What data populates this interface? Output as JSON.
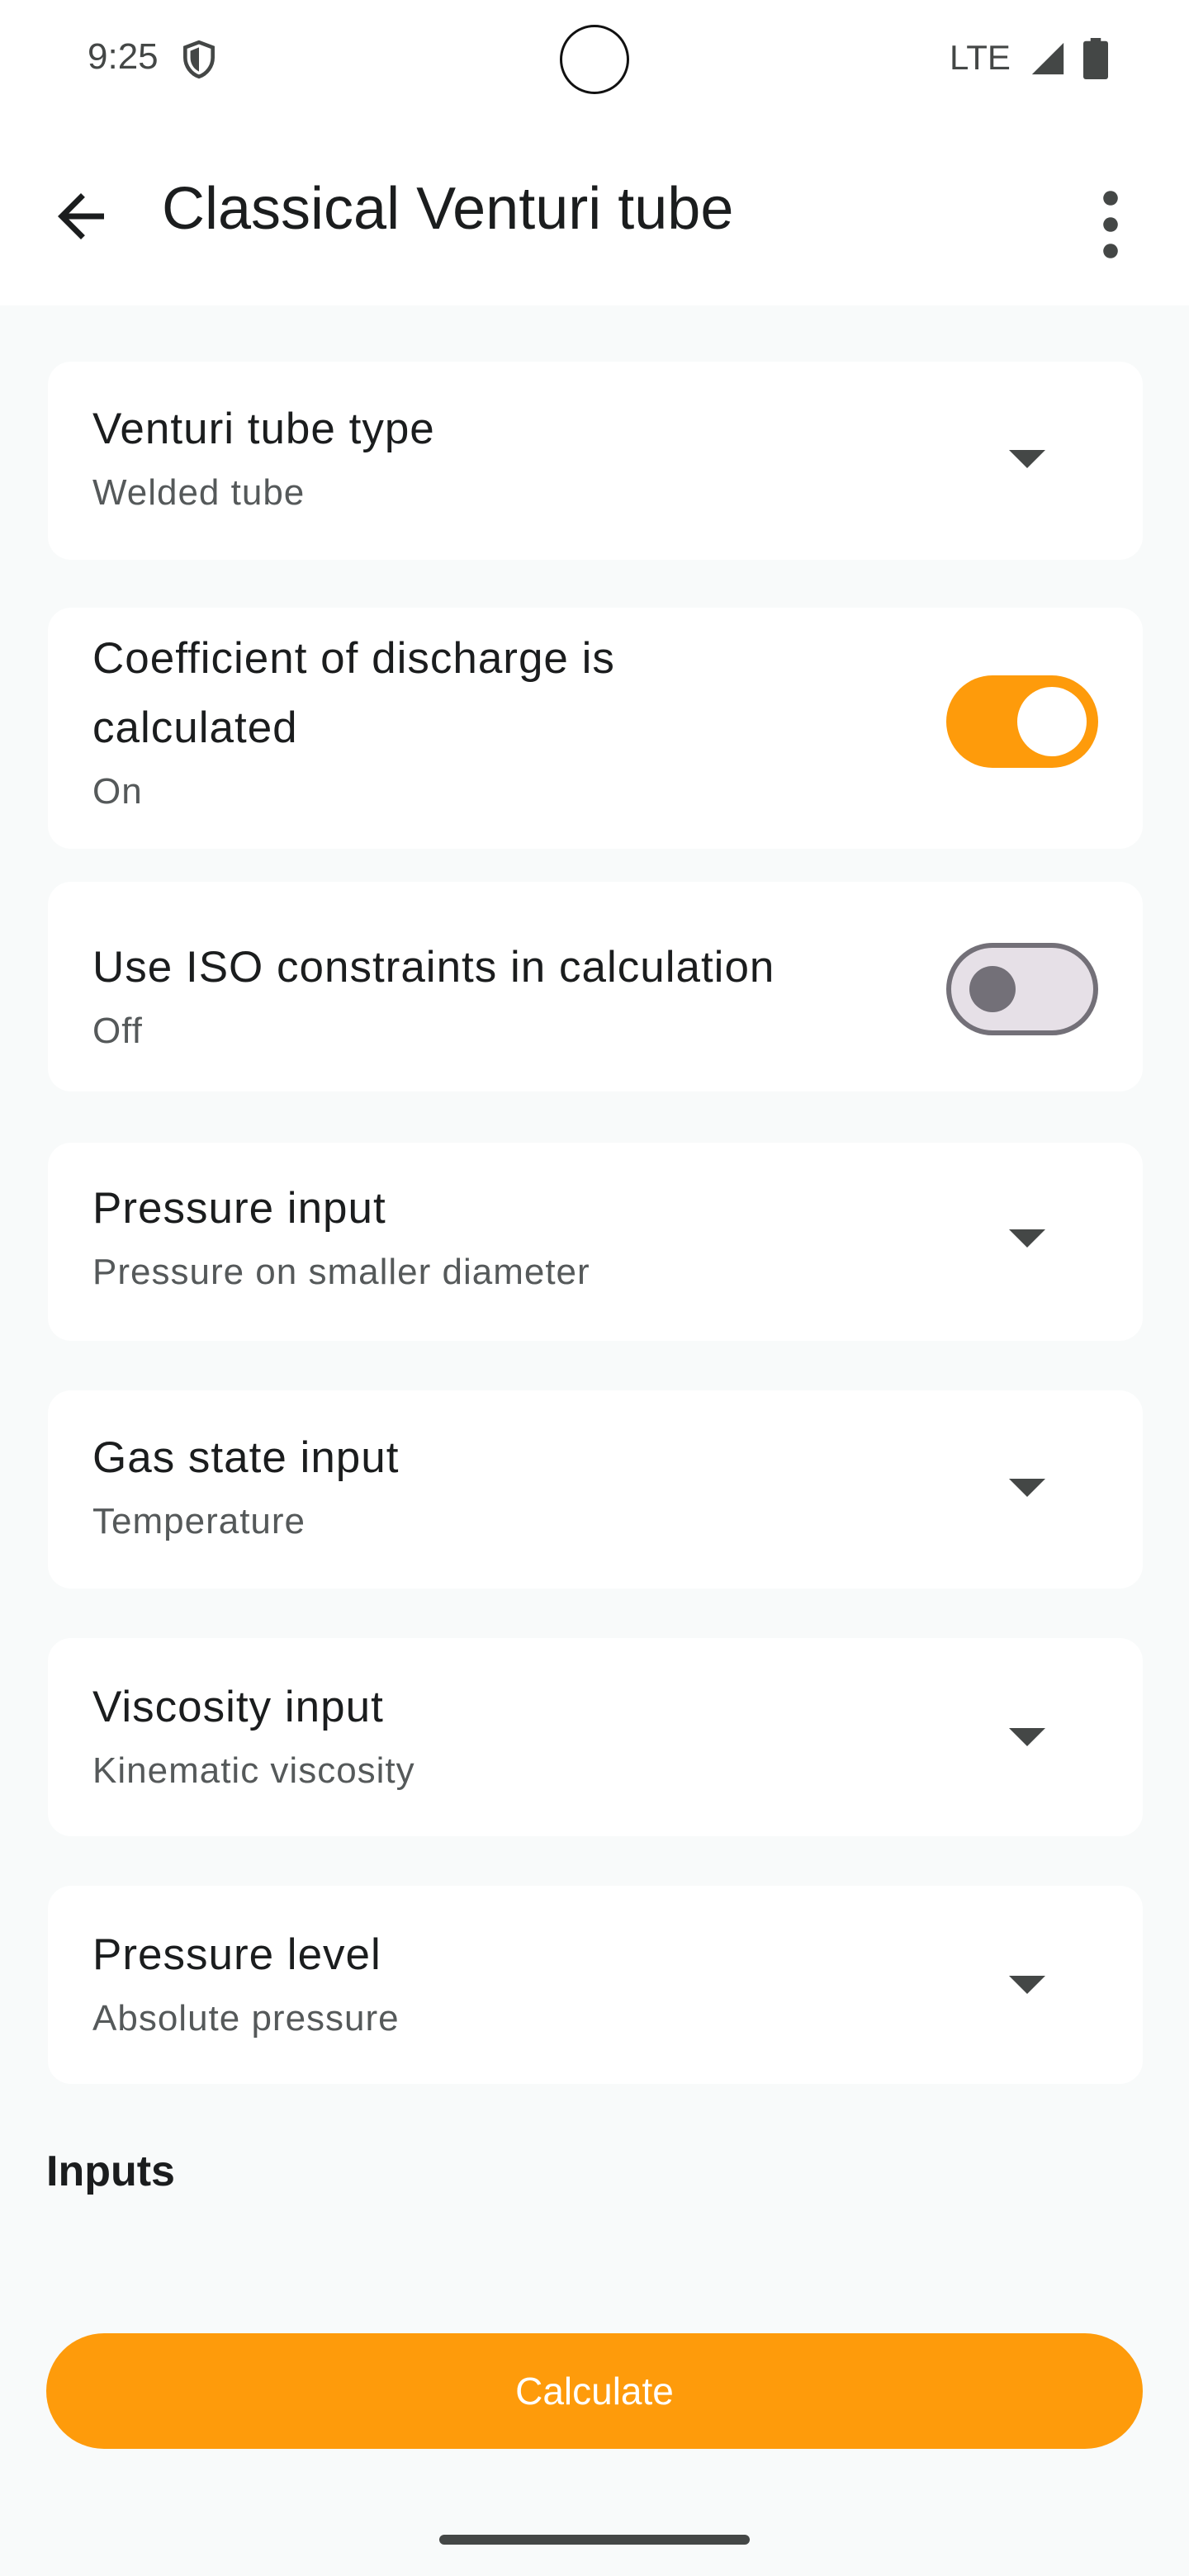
{
  "status_bar": {
    "time": "9:25",
    "network": "LTE",
    "icons": [
      "shield-icon",
      "signal-icon",
      "battery-icon"
    ]
  },
  "app_bar": {
    "title": "Classical Venturi tube",
    "back_icon": "arrow-back-icon",
    "menu_icon": "more-vert-icon"
  },
  "settings": [
    {
      "title": "Venturi tube type",
      "value": "Welded tube",
      "control": "dropdown"
    },
    {
      "title_line1": "Coefficient of discharge is",
      "title_line2": "calculated",
      "value": "On",
      "control": "toggle",
      "checked": true
    },
    {
      "title": "Use ISO constraints in calculation",
      "value": "Off",
      "control": "toggle",
      "checked": false
    },
    {
      "title": "Pressure input",
      "value": "Pressure on smaller diameter",
      "control": "dropdown"
    },
    {
      "title": "Gas state input",
      "value": "Temperature",
      "control": "dropdown"
    },
    {
      "title": "Viscosity input",
      "value": "Kinematic viscosity",
      "control": "dropdown"
    },
    {
      "title": "Pressure level",
      "value": "Absolute pressure",
      "control": "dropdown"
    }
  ],
  "inputs_section": {
    "label": "Inputs"
  },
  "calculate_button": {
    "label": "Calculate"
  },
  "colors": {
    "accent": "#FE9B0B",
    "background": "#F8FAFA",
    "card": "#FFFFFF",
    "text_primary": "#1B1D1E",
    "text_secondary": "#55595A"
  }
}
